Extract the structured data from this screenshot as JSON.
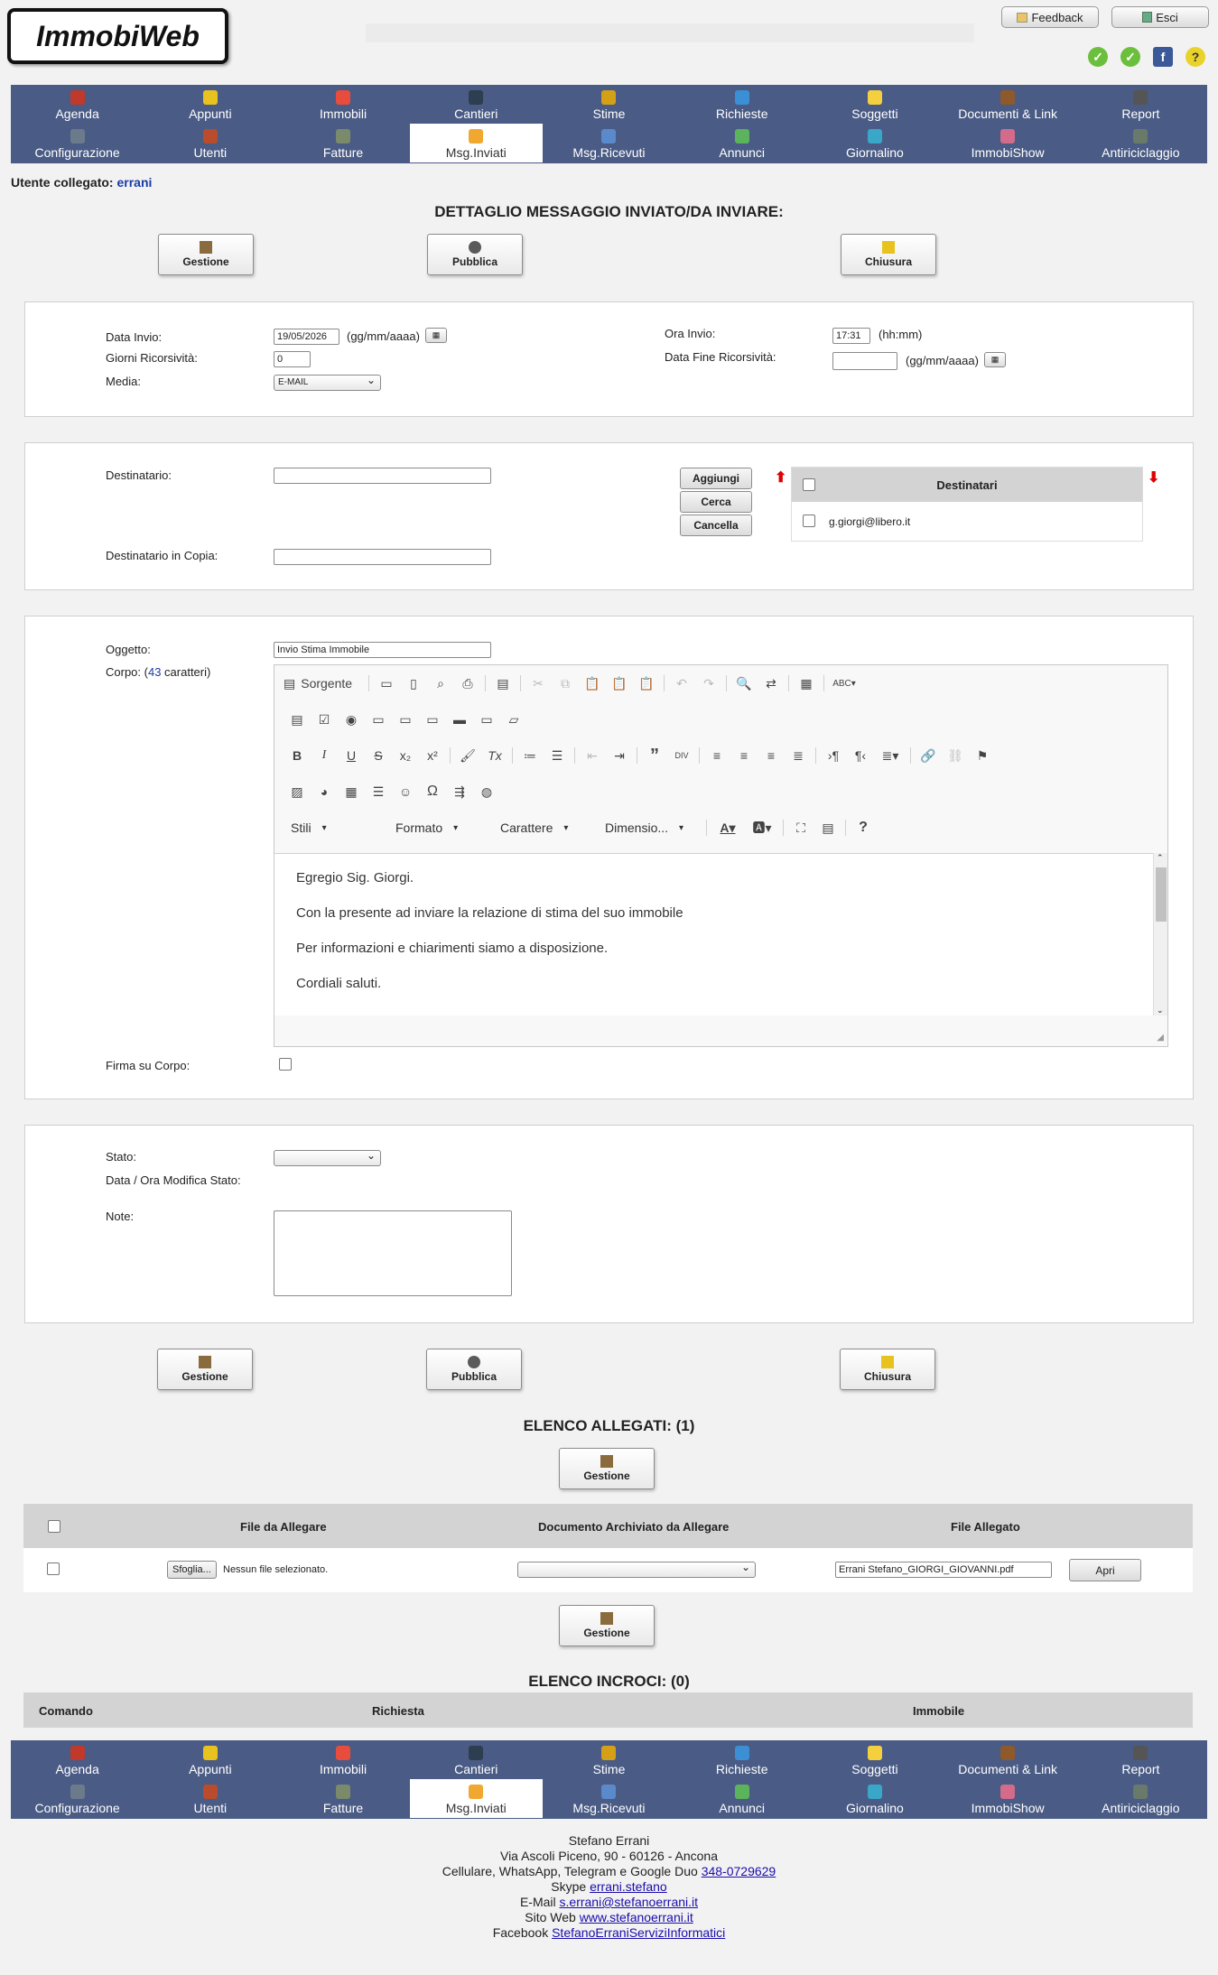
{
  "header": {
    "logo": "ImmobiWeb",
    "feedback": "Feedback",
    "logout": "Esci"
  },
  "menu": {
    "row1": [
      "Agenda",
      "Appunti",
      "Immobili",
      "Cantieri",
      "Stime",
      "Richieste",
      "Soggetti",
      "Documenti & Link",
      "Report"
    ],
    "row2": [
      "Configurazione",
      "Utenti",
      "Fatture",
      "Msg.Inviati",
      "Msg.Ricevuti",
      "Annunci",
      "Giornalino",
      "ImmobiShow",
      "Antiriciclaggio"
    ],
    "active": "Msg.Inviati"
  },
  "user": {
    "label": "Utente collegato:",
    "name": "errani"
  },
  "title": "DETTAGLIO MESSAGGIO INVIATO/DA INVIARE:",
  "actions": {
    "gestione": "Gestione",
    "pubblica": "Pubblica",
    "chiusura": "Chiusura"
  },
  "invio": {
    "data_label": "Data Invio:",
    "data_value": "19/05/2026",
    "data_hint": "(gg/mm/aaaa)",
    "ora_label": "Ora Invio:",
    "ora_value": "17:31",
    "ora_hint": "(hh:mm)",
    "giorni_label": "Giorni Ricorsività:",
    "giorni_value": "0",
    "fine_label": "Data Fine Ricorsività:",
    "fine_value": "",
    "fine_hint": "(gg/mm/aaaa)",
    "media_label": "Media:",
    "media_value": "E-MAIL"
  },
  "destinatari": {
    "dest_label": "Destinatario:",
    "dest_value": "",
    "copia_label": "Destinatario in Copia:",
    "copia_value": "",
    "aggiungi": "Aggiungi",
    "cerca": "Cerca",
    "cancella": "Cancella",
    "list_header": "Destinatari",
    "list": [
      "g.giorgi@libero.it"
    ]
  },
  "messaggio": {
    "oggetto_label": "Oggetto:",
    "oggetto_value": "Invio Stima Immobile",
    "corpo_label_pre": "Corpo: (",
    "corpo_count": "43",
    "corpo_label_post": " caratteri)",
    "firma_label": "Firma su Corpo:",
    "toolbar_source": "Sorgente",
    "combos": [
      "Stili",
      "Formato",
      "Carattere",
      "Dimensio..."
    ],
    "body": [
      "Egregio Sig. Giorgi.",
      "Con la presente ad inviare la relazione di stima del suo immobile",
      "Per informazioni e chiarimenti siamo a disposizione.",
      "Cordiali saluti."
    ]
  },
  "stato": {
    "stato_label": "Stato:",
    "stato_value": "",
    "data_mod_label": "Data / Ora Modifica Stato:",
    "note_label": "Note:",
    "note_value": ""
  },
  "allegati": {
    "title": "ELENCO ALLEGATI: (1)",
    "col_file": "File da Allegare",
    "col_doc": "Documento Archiviato da Allegare",
    "col_allegato": "File Allegato",
    "browse": "Sfoglia...",
    "no_file": "Nessun file selezionato.",
    "doc_value": "",
    "allegato_value": "Errani Stefano_GIORGI_GIOVANNI.pdf",
    "apri": "Apri"
  },
  "incroci": {
    "title": "ELENCO INCROCI: (0)",
    "col_comando": "Comando",
    "col_richiesta": "Richiesta",
    "col_immobile": "Immobile"
  },
  "footer": {
    "name": "Stefano Errani",
    "address": "Via Ascoli Piceno, 90 - 60126 - Ancona",
    "phone_label": "Cellulare, WhatsApp, Telegram e Google Duo",
    "phone": "348-0729629",
    "skype_label": "Skype",
    "skype": "errani.stefano",
    "email_label": "E-Mail",
    "email": "s.errani@stefanoerrani.it",
    "site_label": "Sito Web",
    "site": "www.stefanoerrani.it",
    "fb_label": "Facebook",
    "fb": "StefanoErraniServiziInformatici"
  },
  "colors": {
    "menu_bg": "#4a5b85",
    "header_gray": "#d3d3d3",
    "link": "#1a0dab"
  }
}
